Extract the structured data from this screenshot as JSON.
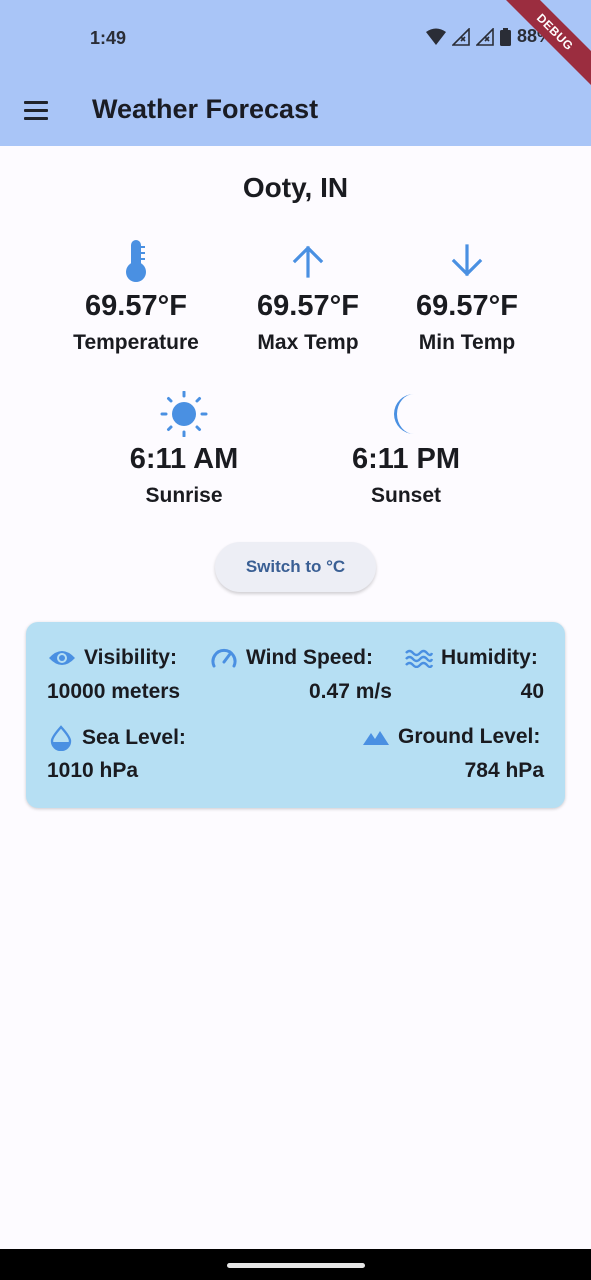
{
  "status_bar": {
    "time": "1:49",
    "battery": "88%"
  },
  "debug_banner": "DEBUG",
  "app_bar": {
    "title": "Weather Forecast",
    "menu_icon": "hamburger-menu-icon"
  },
  "location": "Ooty, IN",
  "stats_row1": [
    {
      "icon": "thermometer-icon",
      "value": "69.57°F",
      "label": "Temperature"
    },
    {
      "icon": "arrow-up-icon",
      "value": "69.57°F",
      "label": "Max Temp"
    },
    {
      "icon": "arrow-down-icon",
      "value": "69.57°F",
      "label": "Min Temp"
    }
  ],
  "stats_row2": [
    {
      "icon": "sun-icon",
      "value": "6:11 AM",
      "label": "Sunrise"
    },
    {
      "icon": "moon-icon",
      "value": "6:11 PM",
      "label": "Sunset"
    }
  ],
  "switch_button": "Switch to °C",
  "details": {
    "visibility": {
      "label": "Visibility:",
      "value": "10000 meters",
      "icon": "eye-icon"
    },
    "wind_speed": {
      "label": "Wind Speed:",
      "value": "0.47 m/s",
      "icon": "speedometer-icon"
    },
    "humidity": {
      "label": "Humidity:",
      "value": "40",
      "icon": "waves-icon"
    },
    "sea_level": {
      "label": "Sea Level:",
      "value": "1010 hPa",
      "icon": "water-drop-icon"
    },
    "ground_level": {
      "label": "Ground Level:",
      "value": "784 hPa",
      "icon": "terrain-icon"
    }
  },
  "colors": {
    "accent": "#4a90e2",
    "app_bar": "#a9c5f7",
    "card": "#b6dff3"
  }
}
